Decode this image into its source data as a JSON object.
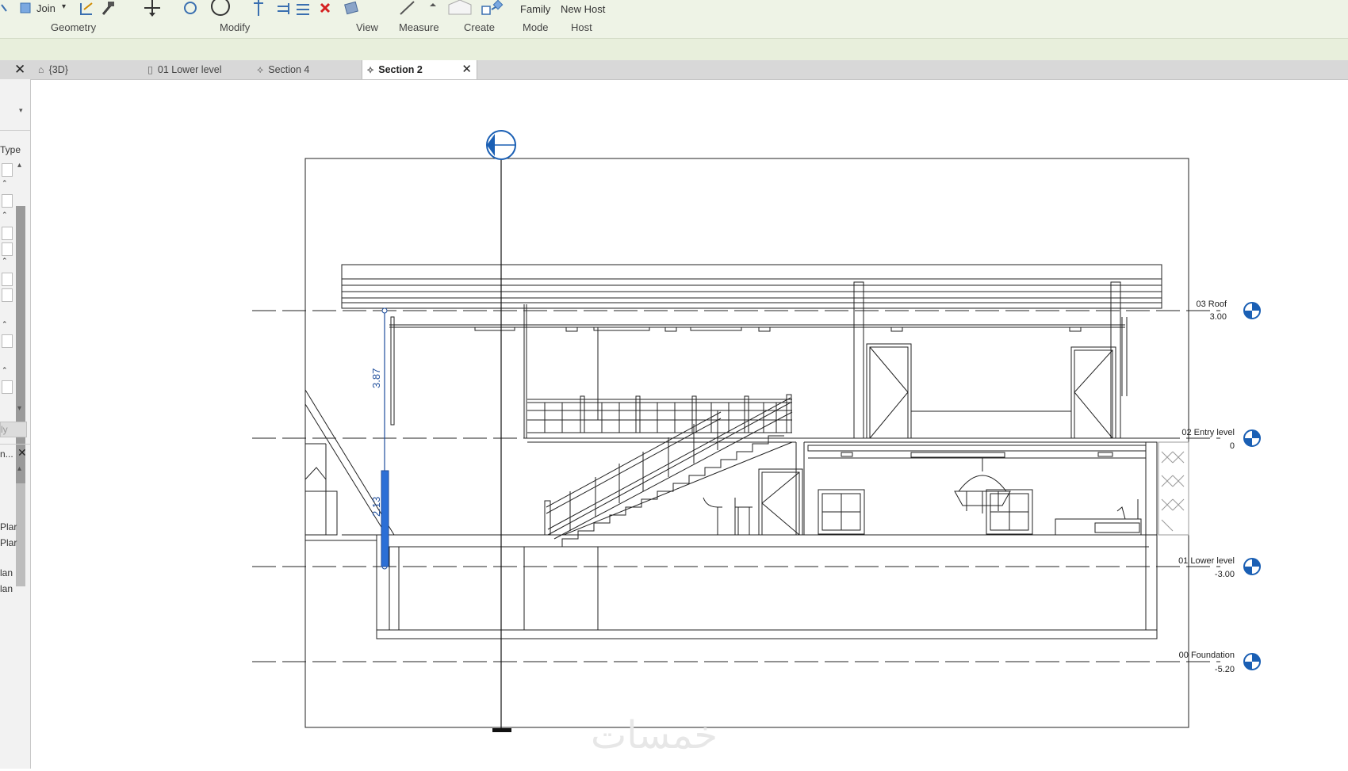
{
  "ribbon": {
    "join_label": "Join",
    "family_label": "Family",
    "new_host_label": "New Host",
    "panels": {
      "geometry": "Geometry",
      "modify": "Modify",
      "view": "View",
      "measure": "Measure",
      "create": "Create",
      "mode": "Mode",
      "host": "Host"
    }
  },
  "tabs": [
    {
      "label": "{3D}",
      "icon": "3d-view-icon",
      "active": false
    },
    {
      "label": "01 Lower level",
      "icon": "floor-plan-icon",
      "active": false
    },
    {
      "label": "Section 4",
      "icon": "section-icon",
      "active": false
    },
    {
      "label": "Section 2",
      "icon": "section-icon",
      "active": true
    }
  ],
  "left_panel": {
    "type_label": "Type",
    "apply_label": "ly",
    "browser_header": "n...",
    "browser_items": [
      "Plar",
      "Plar",
      "lan",
      "lan"
    ]
  },
  "levels": [
    {
      "name": "03 Roof",
      "elevation": "3.00"
    },
    {
      "name": "02 Entry level",
      "elevation": "0"
    },
    {
      "name": "01 Lower level",
      "elevation": "-3.00"
    },
    {
      "name": "00 Foundation",
      "elevation": "-5.20"
    }
  ],
  "dimensions": {
    "upper": "3.87",
    "lower": "2.13"
  },
  "section_head": {
    "tag": "---"
  },
  "watermark": "خمسات",
  "colors": {
    "ribbon_bg": "#eef3e6",
    "selection_blue": "#1f4e9c",
    "level_head_blue": "#1a5fb4"
  }
}
